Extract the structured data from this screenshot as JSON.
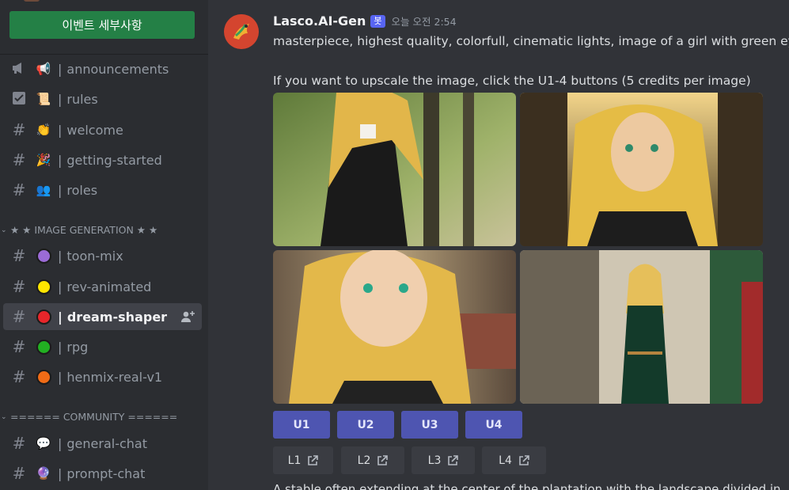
{
  "sidebar": {
    "event_button": "이벤트 세부사항",
    "channels_top": [
      {
        "kind": "announcement-icon",
        "emoji": "📢",
        "name": "announcements"
      },
      {
        "kind": "rules-icon",
        "emoji": "📜",
        "name": "rules"
      },
      {
        "kind": "hash",
        "emoji": "👏",
        "name": "welcome"
      },
      {
        "kind": "hash",
        "emoji": "🎉",
        "name": "getting-started"
      },
      {
        "kind": "hash",
        "emoji": "👥",
        "name": "roles"
      }
    ],
    "category_image": "★ ★ IMAGE GENERATION ★ ★",
    "channels_image": [
      {
        "dot_color": "#9b6bd6",
        "name": "toon-mix"
      },
      {
        "dot_color": "#ffe600",
        "name": "rev-animated"
      },
      {
        "dot_color": "#e8262a",
        "name": "dream-shaper",
        "active": true
      },
      {
        "dot_color": "#22b022",
        "name": "rpg"
      },
      {
        "dot_color": "#f06b16",
        "name": "henmix-real-v1"
      }
    ],
    "category_community": "====== COMMUNITY ======",
    "channels_community": [
      {
        "emoji": "💬",
        "name": "general-chat"
      },
      {
        "emoji": "🔮",
        "name": "prompt-chat"
      }
    ],
    "hash_glyph": "#",
    "pipe": "|"
  },
  "message": {
    "author": "Lasco.AI-Gen",
    "bot_tag": "봇",
    "timestamp": "오늘 오전 2:54",
    "prompt_line": "masterpiece, highest quality, colorfull, cinematic lights, image of a girl with green eyes",
    "upscale_line": "If you want to upscale the image, click the U1-4 buttons  (5 credits per image)",
    "u_buttons": [
      "U1",
      "U2",
      "U3",
      "U4"
    ],
    "l_buttons": [
      "L1",
      "L2",
      "L3",
      "L4"
    ],
    "next_line": "A stable often extending at the center of the plantation with the landscape divided in"
  },
  "colors": {
    "accent": "#5865f2",
    "event_button": "#248046",
    "u_button": "#4e55b1"
  }
}
